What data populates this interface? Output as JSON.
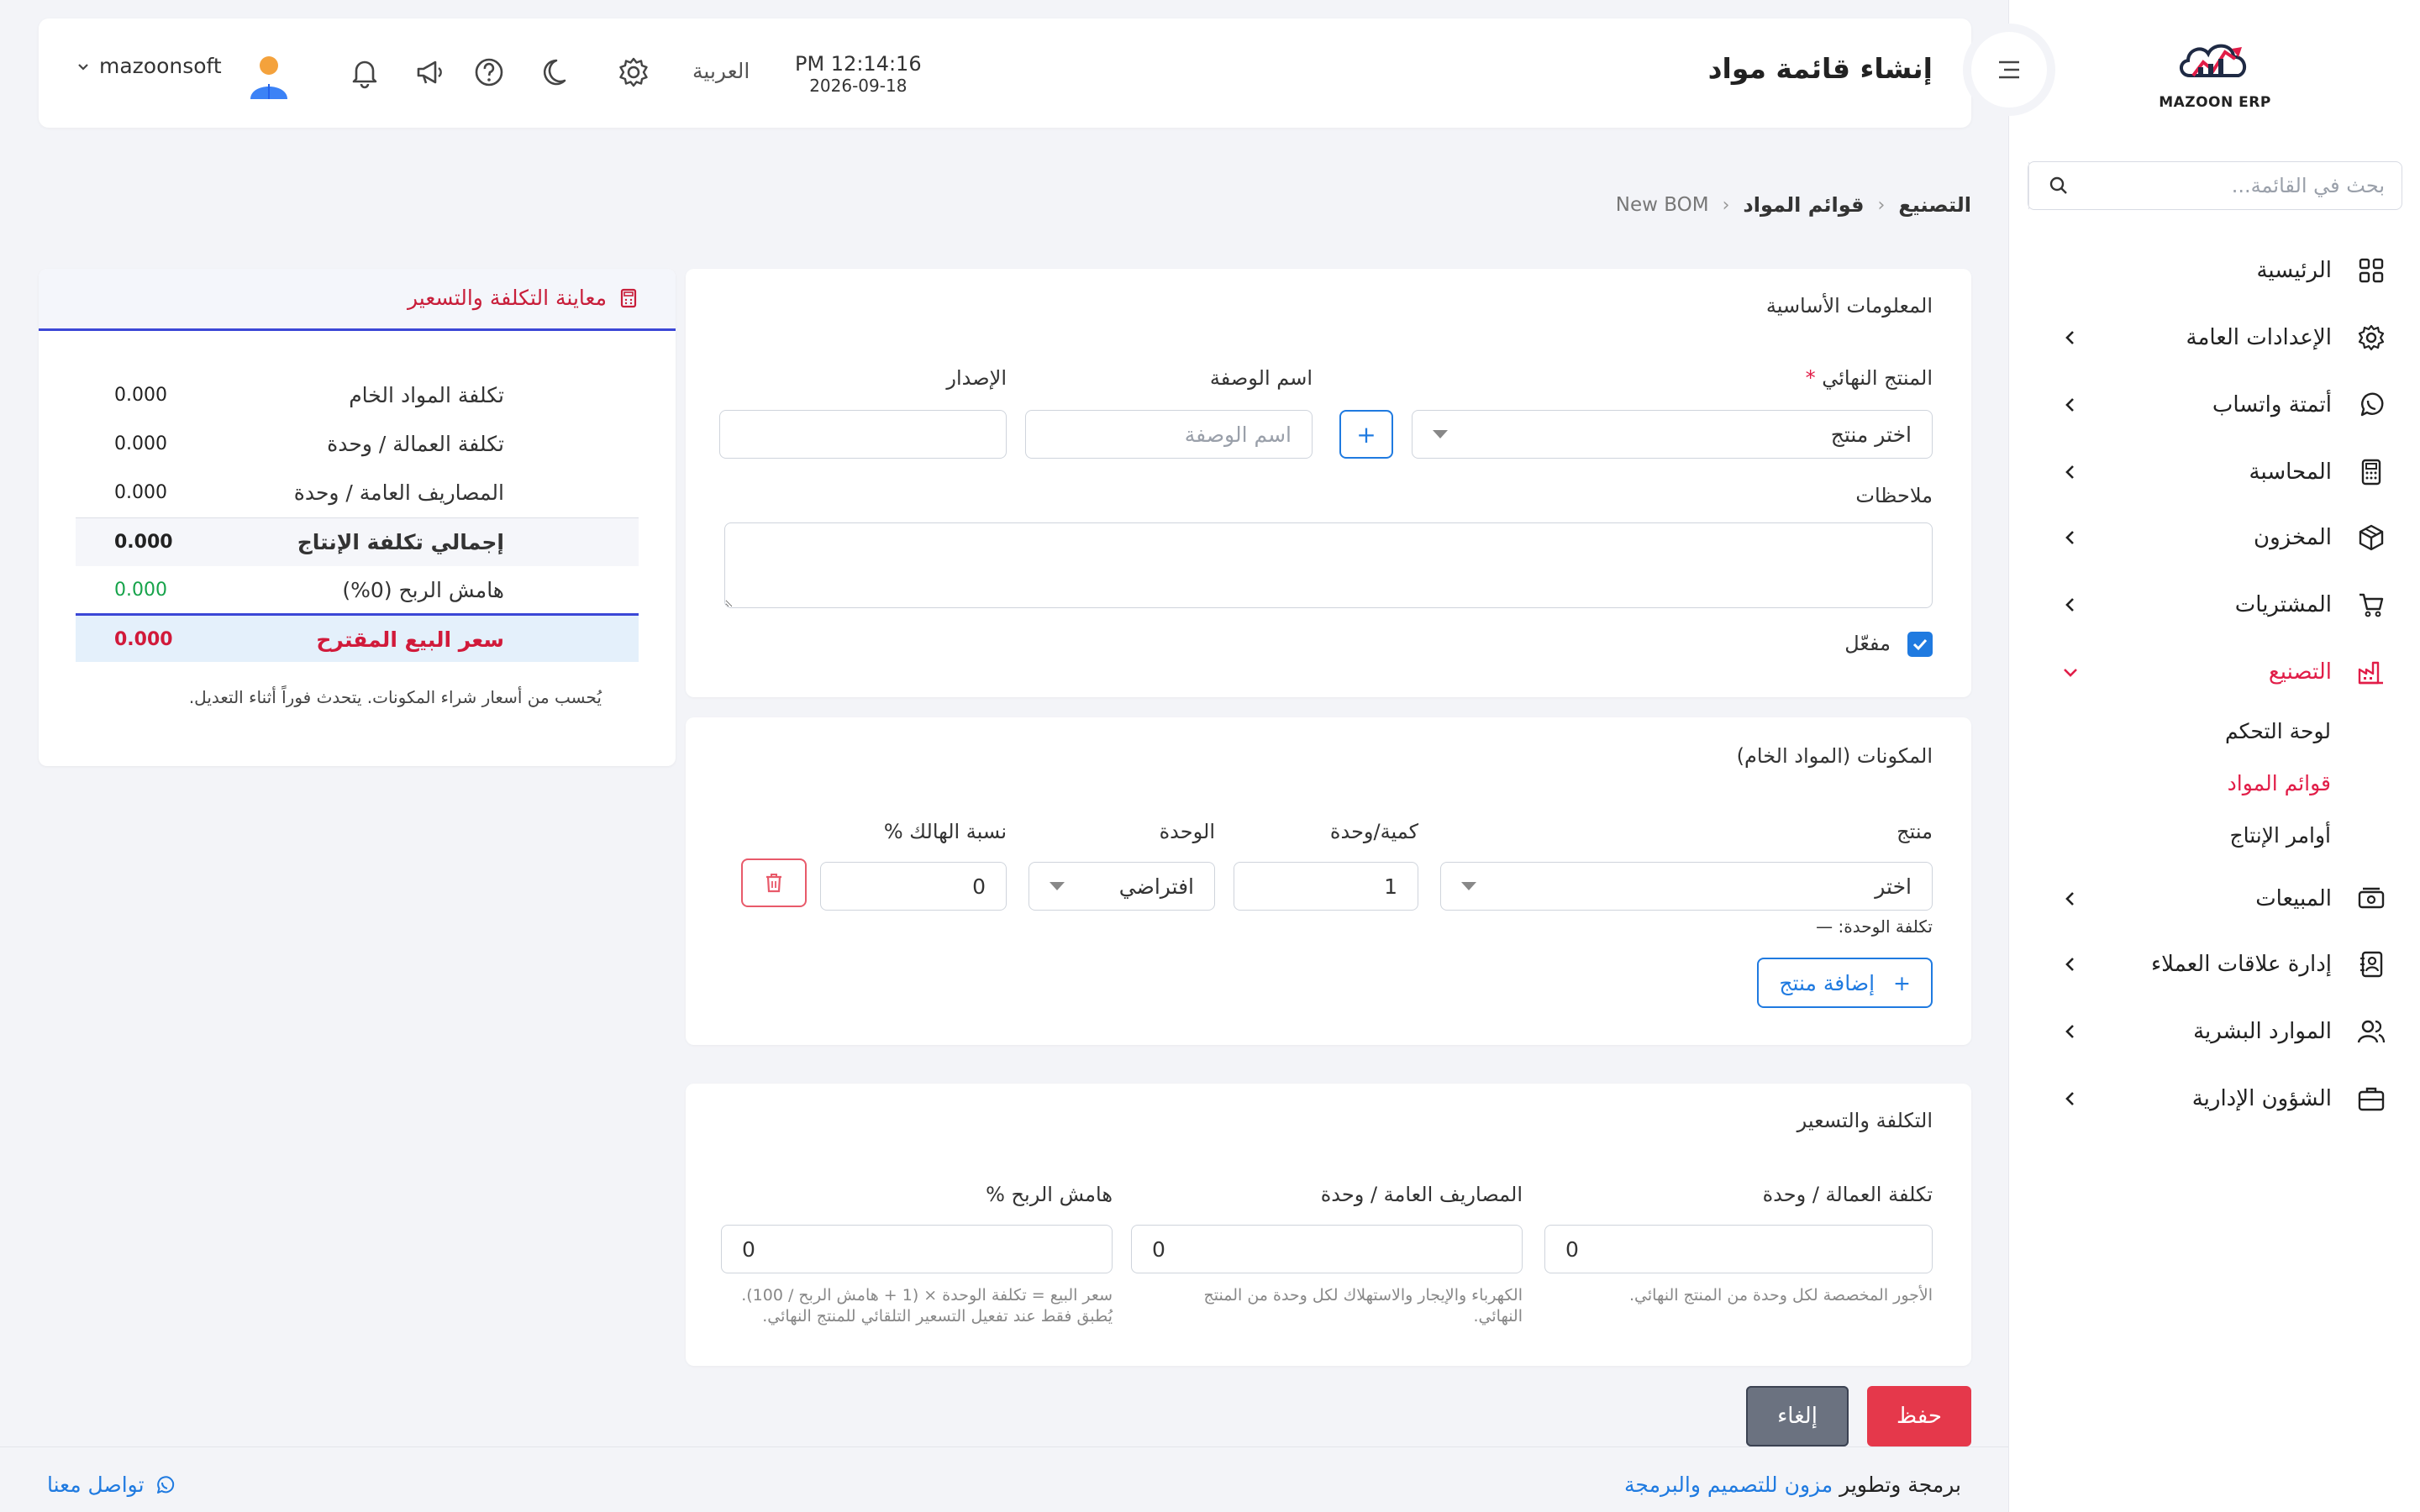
{
  "app": {
    "logo_text": "MAZOON ERP"
  },
  "sidebar": {
    "search_placeholder": "بحث في القائمة...",
    "items": [
      {
        "label": "الرئيسية"
      },
      {
        "label": "الإعدادات العامة"
      },
      {
        "label": "أتمتة واتساب"
      },
      {
        "label": "المحاسبة"
      },
      {
        "label": "المخزون"
      },
      {
        "label": "المشتريات"
      },
      {
        "label": "التصنيع"
      },
      {
        "label": "المبيعات"
      },
      {
        "label": "إدارة علاقات العملاء"
      },
      {
        "label": "الموارد البشرية"
      },
      {
        "label": "الشؤون الإدارية"
      }
    ],
    "sub_items": [
      {
        "label": "لوحة التحكم"
      },
      {
        "label": "قوائم المواد"
      },
      {
        "label": "أوامر الإنتاج"
      }
    ],
    "active_color": "#e11d48"
  },
  "header": {
    "title": "إنشاء قائمة مواد",
    "time": "PM 12:14:16",
    "date": "2026-09-18",
    "language": "العربية",
    "username": "mazoonsoft"
  },
  "breadcrumb": {
    "level1": "التصنيع",
    "level2": "قوائم المواد",
    "level3": "New BOM"
  },
  "basic_info": {
    "title": "المعلومات الأساسية",
    "product_label": "المنتج النهائي",
    "required_mark": "*",
    "product_value": "اختر منتج",
    "add_symbol": "+",
    "recipe_label": "اسم الوصفة",
    "recipe_placeholder": "اسم الوصفة",
    "version_label": "الإصدار",
    "version_value": "",
    "notes_label": "ملاحظات",
    "notes_value": "",
    "active_label": "مفعّل"
  },
  "components": {
    "title": "المكونات (المواد الخام)",
    "headers": {
      "product": "منتج",
      "qty": "كمية/وحدة",
      "unit": "الوحدة",
      "waste": "نسبة الهالك %"
    },
    "rows": [
      {
        "product": "اختر",
        "qty": "1",
        "unit": "افتراضي",
        "waste": "0",
        "unit_cost_label": "تكلفة الوحدة: —"
      }
    ],
    "add_button": "إضافة منتج",
    "add_symbol": "+"
  },
  "pricing": {
    "title": "التكلفة والتسعير",
    "labor_label": "تكلفة العمالة / وحدة",
    "labor_value": "0",
    "labor_hint": "الأجور المخصصة لكل وحدة من المنتج النهائي.",
    "overhead_label": "المصاريف العامة / وحدة",
    "overhead_value": "0",
    "overhead_hint_1": "الكهرباء والإيجار والاستهلاك لكل وحدة من المنتج",
    "overhead_hint_2": "النهائي.",
    "margin_label": "هامش الربح %",
    "margin_value": "0",
    "margin_hint_1": "سعر البيع = تكلفة الوحدة × (1 + هامش الربح / 100).",
    "margin_hint_2": "يُطبق فقط عند تفعيل التسعير التلقائي للمنتج النهائي."
  },
  "preview": {
    "title": "معاينة التكلفة والتسعير",
    "rows": [
      {
        "label": "تكلفة المواد الخام",
        "value": "0.000"
      },
      {
        "label": "تكلفة العمالة / وحدة",
        "value": "0.000"
      },
      {
        "label": "المصاريف العامة / وحدة",
        "value": "0.000"
      },
      {
        "label": "إجمالي تكلفة الإنتاج",
        "value": "0.000"
      },
      {
        "label": "هامش الربح (0%)",
        "value": "0.000"
      },
      {
        "label": "سعر البيع المقترح",
        "value": "0.000"
      }
    ],
    "note": "يُحسب من أسعار شراء المكونات. يتحدث فوراً أثناء التعديل.",
    "accent_color": "#3b47d6",
    "highlight_color": "#d11a3a",
    "profit_color": "#16a34a"
  },
  "actions": {
    "save": "حفظ",
    "cancel": "إلغاء"
  },
  "footer": {
    "credit_prefix": "برمجة وتطوير",
    "credit_company": "مزون للتصميم والبرمجة",
    "contact": "تواصل معنا"
  }
}
